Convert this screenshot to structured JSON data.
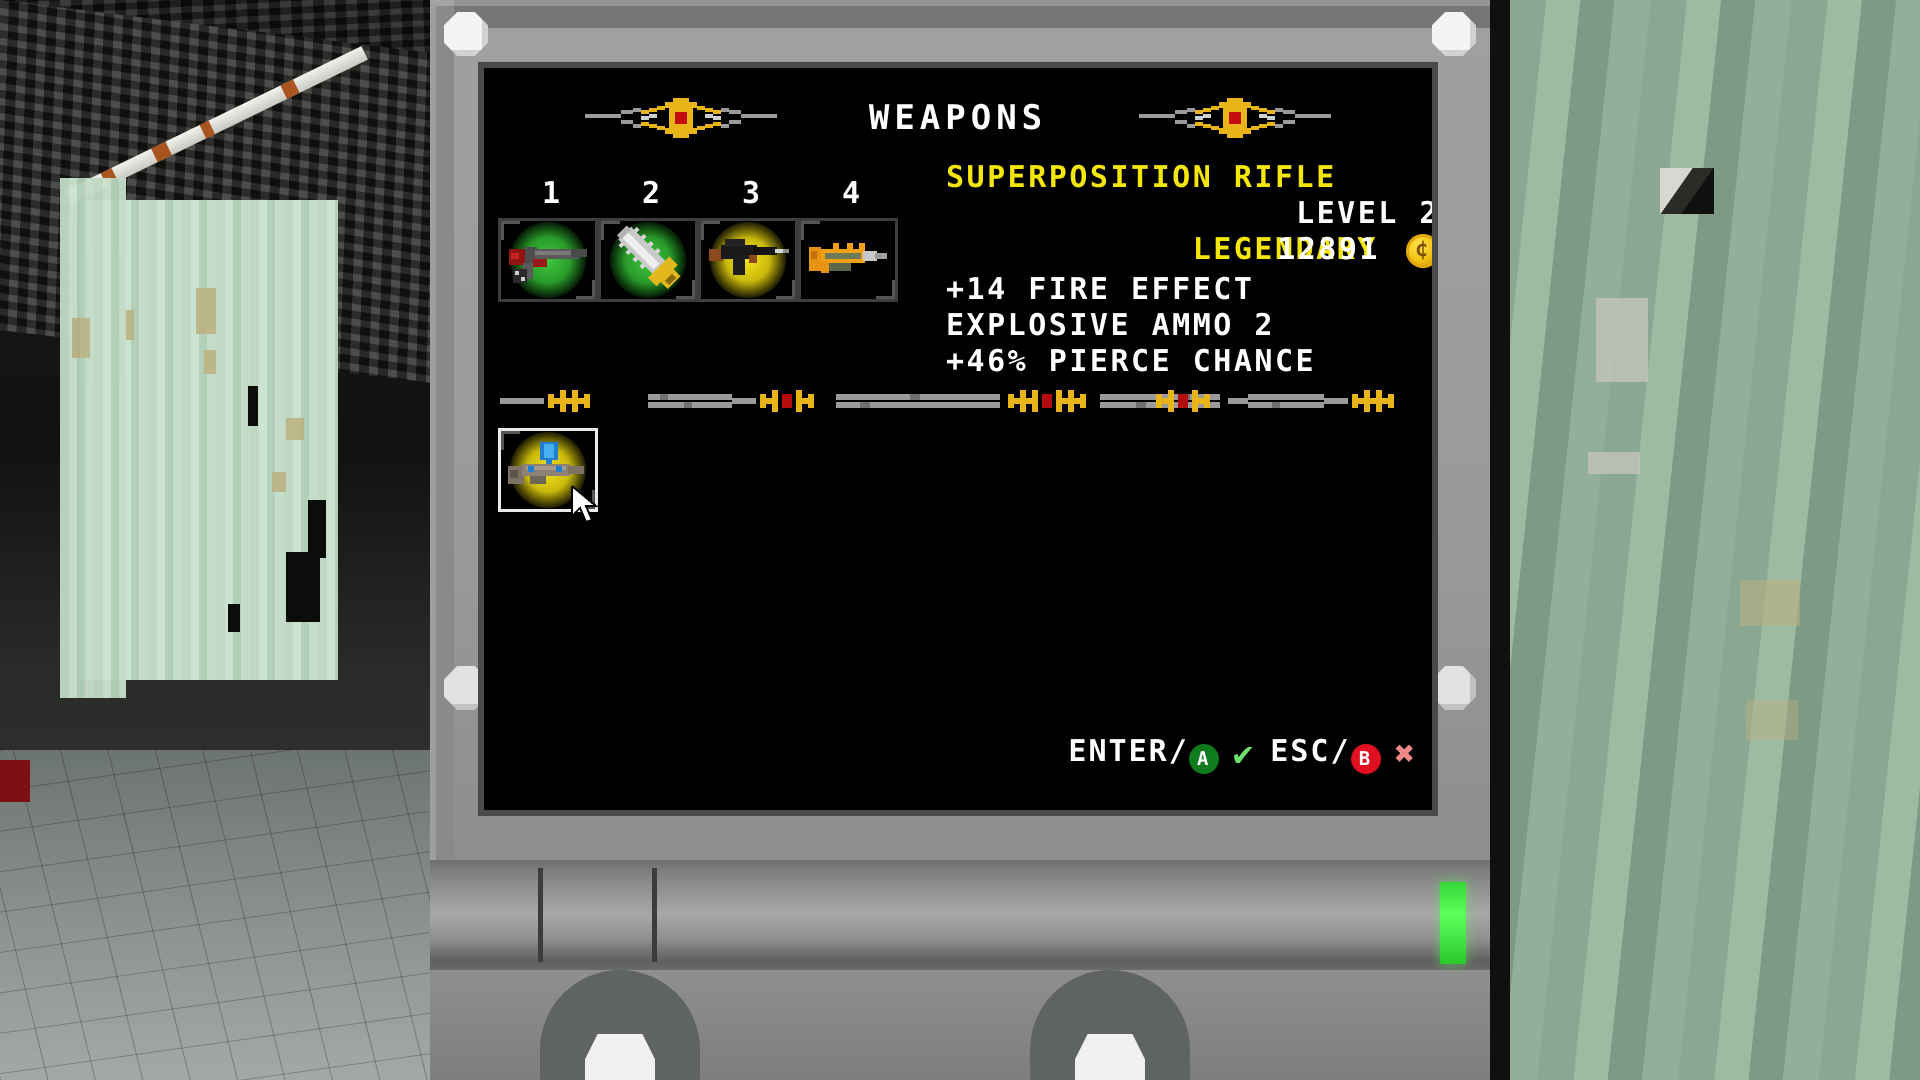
{
  "screen": {
    "title": "WEAPONS",
    "slot_numbers": [
      "1",
      "2",
      "3",
      "4"
    ],
    "slots": [
      {
        "name": "slot-1",
        "icon": "shotgun-icon",
        "glow": "green",
        "selected": false
      },
      {
        "name": "slot-2",
        "icon": "chainsaw-sword-icon",
        "glow": "green",
        "selected": false
      },
      {
        "name": "slot-3",
        "icon": "assault-rifle-icon",
        "glow": "yellow",
        "selected": false
      },
      {
        "name": "slot-4",
        "icon": "superposition-rifle-icon",
        "glow": "none",
        "selected": false
      }
    ],
    "inventory": [
      {
        "name": "inventory-item-1",
        "icon": "energy-rifle-icon",
        "glow": "yellow",
        "selected": true
      }
    ],
    "details": {
      "weapon_name": "SUPERPOSITION RIFLE",
      "rarity": "LEGENDARY",
      "level_label": "LEVEL 2",
      "price": "12891",
      "currency_icon": "coin-icon",
      "stats": [
        "+14 FIRE EFFECT",
        "EXPLOSIVE AMMO 2",
        "+46% PIERCE CHANCE"
      ]
    },
    "footer": {
      "confirm_label": "ENTER/",
      "confirm_button": "A",
      "confirm_mark": "✔",
      "cancel_label": "ESC/",
      "cancel_button": "B",
      "cancel_mark": "✖"
    },
    "colors": {
      "accent_yellow": "#f5e60a",
      "text_white": "#ffffff",
      "background": "#000000",
      "confirm_green": "#0f7a1e",
      "cancel_red": "#e01020",
      "led_green": "#5cff5c"
    },
    "ornament_icon": "winged-emblem-icon",
    "divider_icon": "chain-divider-icon",
    "cursor_icon": "mouse-cursor-icon"
  }
}
